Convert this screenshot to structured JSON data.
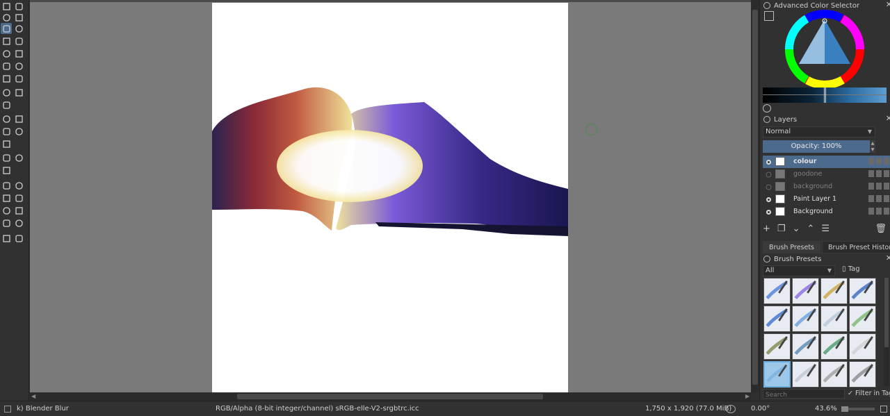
{
  "colors": {
    "accent": "#4b6a8c",
    "canvas_bg": "#7a7a7a",
    "panel_bg": "#313131"
  },
  "toolbox": {
    "tools": [
      {
        "name": "select-shapes-tool-icon"
      },
      {
        "name": "text-tool-icon"
      },
      {
        "name": "edit-shapes-tool-icon"
      },
      {
        "name": "calligraphy-tool-icon"
      },
      {
        "name": "freehand-brush-tool-icon"
      },
      {
        "name": "line-tool-icon"
      },
      {
        "name": "rectangle-tool-icon"
      },
      {
        "name": "ellipse-tool-icon"
      },
      {
        "name": "polygon-tool-icon"
      },
      {
        "name": "polyline-tool-icon"
      },
      {
        "name": "bezier-curve-tool-icon"
      },
      {
        "name": "freehand-path-tool-icon"
      },
      {
        "name": "dynamic-brush-tool-icon"
      },
      {
        "name": "multibrush-tool-icon"
      },
      {
        "name": "transform-tool-icon"
      },
      {
        "name": "move-tool-icon"
      },
      {
        "name": "crop-tool-icon"
      },
      {
        "name": "gradient-tool-icon"
      },
      {
        "name": "color-picker-tool-icon"
      },
      {
        "name": "colorize-mask-tool-icon"
      },
      {
        "name": "smart-patch-tool-icon"
      },
      {
        "name": "fill-tool-icon"
      },
      {
        "name": "assistant-tool-icon"
      },
      {
        "name": "measure-tool-icon"
      },
      {
        "name": "reference-images-tool-icon"
      },
      {
        "name": "rectangular-selection-icon"
      },
      {
        "name": "elliptical-selection-icon"
      },
      {
        "name": "polygonal-selection-icon"
      },
      {
        "name": "freehand-selection-icon"
      },
      {
        "name": "contiguous-selection-icon"
      },
      {
        "name": "similar-color-selection-icon"
      },
      {
        "name": "bezier-selection-icon"
      },
      {
        "name": "magnetic-selection-icon"
      },
      {
        "name": "zoom-tool-icon"
      },
      {
        "name": "pan-tool-icon"
      }
    ]
  },
  "color_selector": {
    "title": "Advanced Color Selector"
  },
  "layers": {
    "title": "Layers",
    "blend_mode": "Normal",
    "opacity_label": "Opacity:  100%",
    "items": [
      {
        "name": "colour",
        "visible": true,
        "selected": true
      },
      {
        "name": "goodone",
        "visible": false,
        "selected": false
      },
      {
        "name": "background",
        "visible": false,
        "selected": false
      },
      {
        "name": "Paint Layer 1",
        "visible": true,
        "selected": false
      },
      {
        "name": "Background",
        "visible": true,
        "selected": false
      }
    ]
  },
  "brush_tabs": {
    "presets_tab": "Brush Presets",
    "history_tab": "Brush Preset History"
  },
  "brush_presets": {
    "title": "Brush Presets",
    "filter": "All",
    "tag_label": "Tag",
    "search_placeholder": "Search",
    "filter_in_tag": "Filter in Tag",
    "selected_index": 12,
    "count": 16
  },
  "status": {
    "brush": "k) Blender Blur",
    "color_space": "RGB/Alpha (8-bit integer/channel)  sRGB-elle-V2-srgbtrc.icc",
    "size": "1,750 x 1,920 (77.0 MiB)",
    "rotation": "0.00°",
    "zoom": "43.6%"
  }
}
